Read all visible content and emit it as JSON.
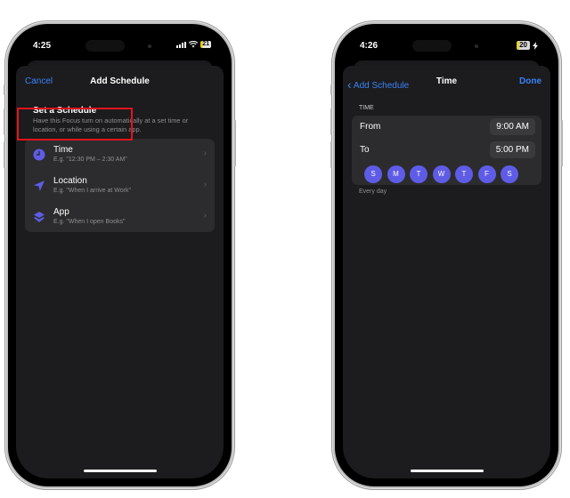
{
  "phone1": {
    "status": {
      "time": "4:25",
      "battery": "21"
    },
    "nav": {
      "cancel": "Cancel",
      "title": "Add Schedule"
    },
    "intro": {
      "heading": "Set a Schedule",
      "description": "Have this Focus turn on automatically at a set time or location, or while using a certain app."
    },
    "options": [
      {
        "title": "Time",
        "subtitle": "E.g. \"12:30 PM – 2:30 AM\"",
        "icon": "clock-icon",
        "highlighted": true
      },
      {
        "title": "Location",
        "subtitle": "E.g. \"When I arrive at Work\"",
        "icon": "location-arrow-icon"
      },
      {
        "title": "App",
        "subtitle": "E.g. \"When I open Books\"",
        "icon": "layers-icon"
      }
    ],
    "chevron": "›"
  },
  "phone2": {
    "status": {
      "time": "4:26",
      "battery": "20"
    },
    "nav": {
      "back": "Add Schedule",
      "back_icon": "‹",
      "title": "Time",
      "done": "Done"
    },
    "section_label": "TIME",
    "from_label": "From",
    "from_value": "9:00 AM",
    "to_label": "To",
    "to_value": "5:00 PM",
    "days": [
      "S",
      "M",
      "T",
      "W",
      "T",
      "F",
      "S"
    ],
    "footer": "Every day"
  },
  "colors": {
    "accent": "#3a82f7",
    "purple": "#5e5ce6",
    "highlight": "#e0141b"
  }
}
